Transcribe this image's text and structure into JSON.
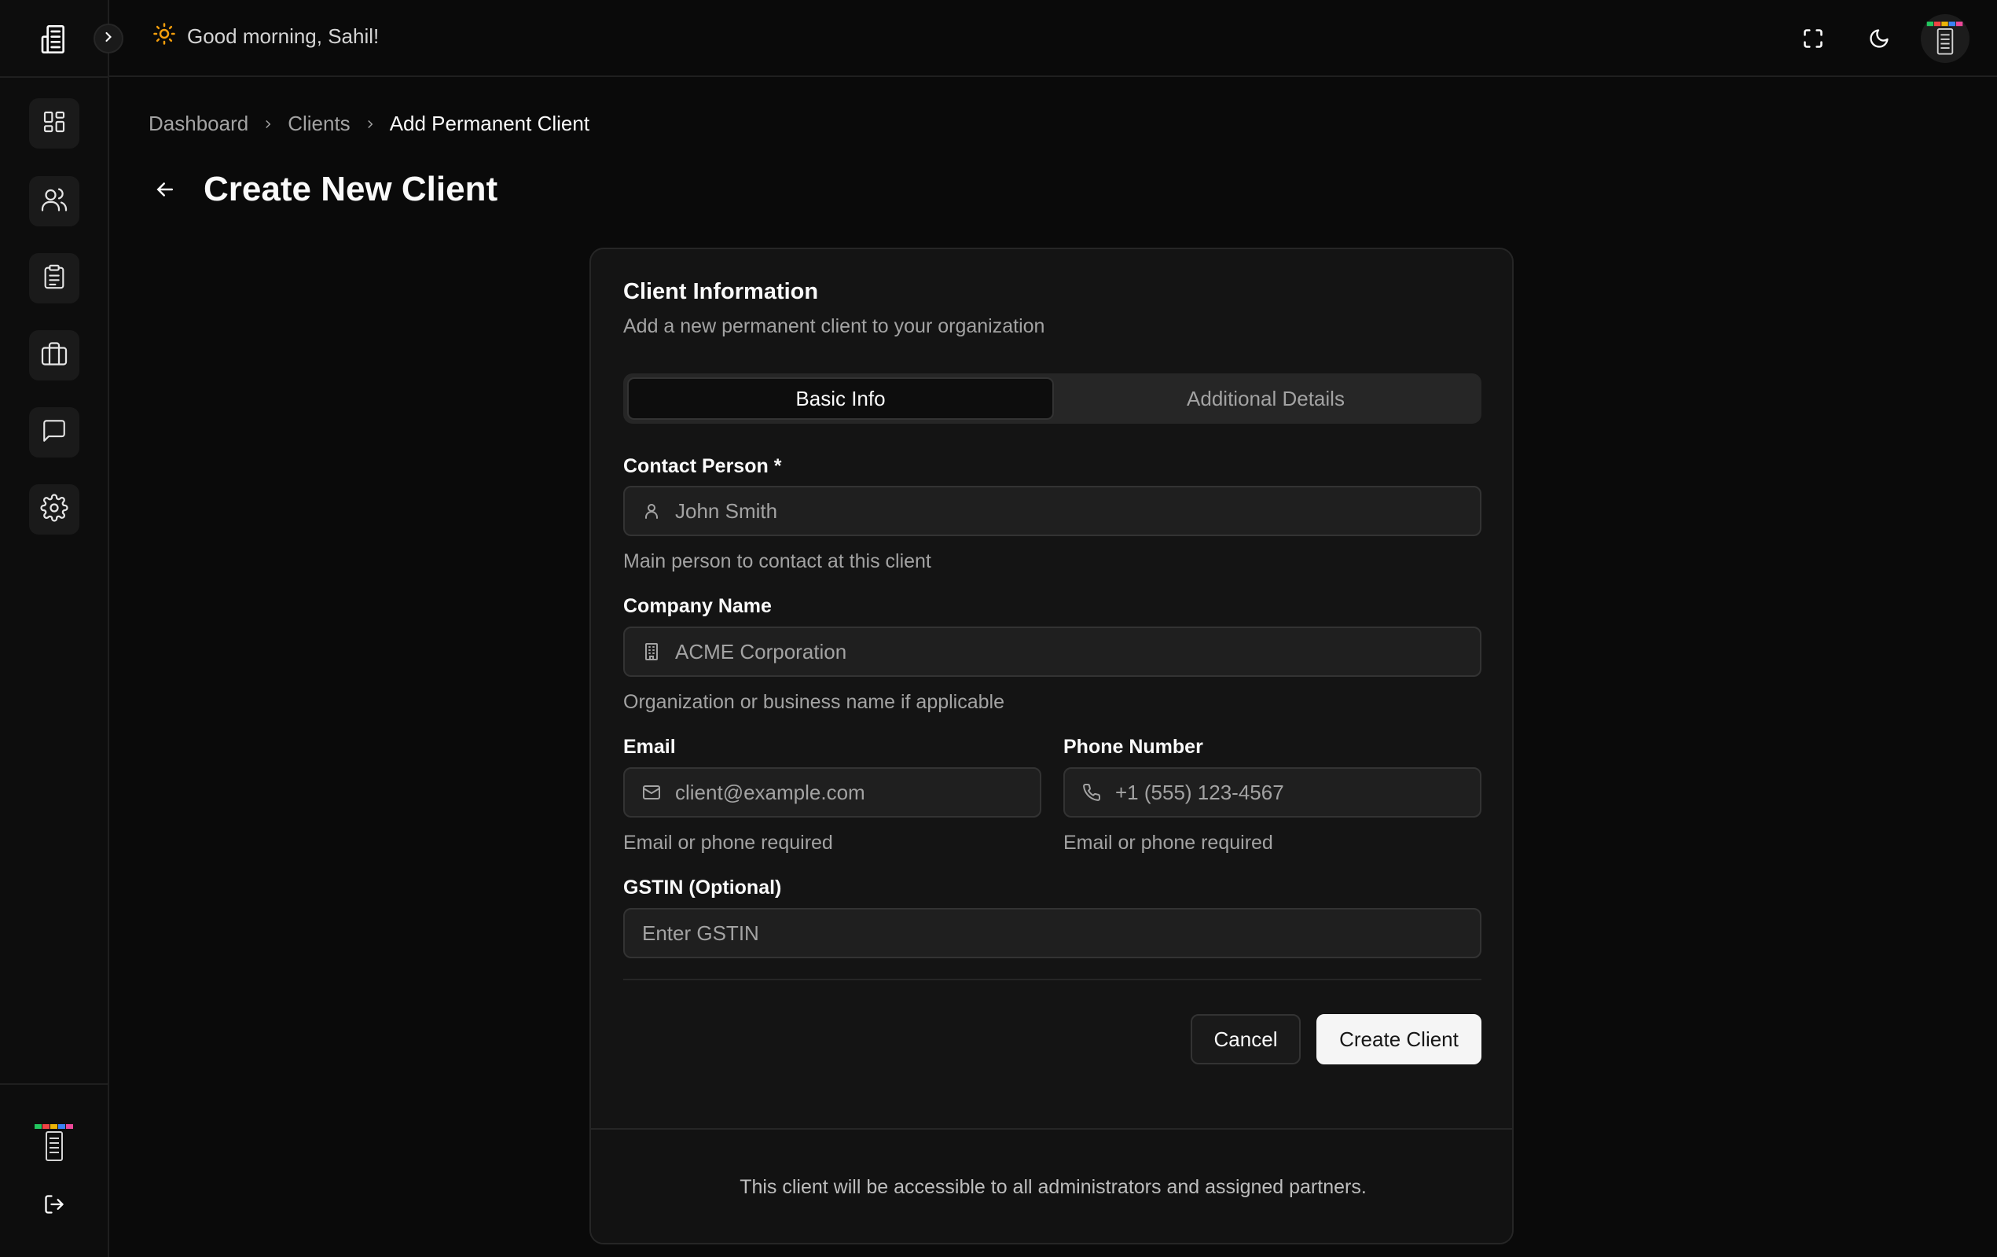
{
  "topbar": {
    "greeting": "Good morning, Sahil!",
    "icons": [
      "sun-icon",
      "fullscreen-icon",
      "moon-icon"
    ]
  },
  "sidebar": {
    "items": [
      {
        "name": "dashboard",
        "icon": "grid-icon"
      },
      {
        "name": "clients",
        "icon": "users-icon"
      },
      {
        "name": "tasks",
        "icon": "clipboard-icon"
      },
      {
        "name": "work",
        "icon": "briefcase-icon"
      },
      {
        "name": "messages",
        "icon": "chat-icon"
      },
      {
        "name": "settings",
        "icon": "gear-icon"
      }
    ]
  },
  "breadcrumb": {
    "items": [
      "Dashboard",
      "Clients"
    ],
    "current": "Add Permanent Client"
  },
  "page": {
    "title": "Create New Client"
  },
  "card": {
    "title": "Client Information",
    "description": "Add a new permanent client to your organization",
    "tabs": [
      {
        "label": "Basic Info",
        "active": true
      },
      {
        "label": "Additional Details",
        "active": false
      }
    ],
    "fields": {
      "contact_person": {
        "label": "Contact Person *",
        "placeholder": "John Smith",
        "hint": "Main person to contact at this client"
      },
      "company_name": {
        "label": "Company Name",
        "placeholder": "ACME Corporation",
        "hint": "Organization or business name if applicable"
      },
      "email": {
        "label": "Email",
        "placeholder": "client@example.com",
        "hint": "Email or phone required"
      },
      "phone": {
        "label": "Phone Number",
        "placeholder": "+1 (555) 123-4567",
        "hint": "Email or phone required"
      },
      "gstin": {
        "label": "GSTIN (Optional)",
        "placeholder": "Enter GSTIN"
      }
    },
    "buttons": {
      "cancel": "Cancel",
      "create": "Create Client"
    },
    "footer": "This client will be accessible to all administrators and assigned partners."
  },
  "colors": {
    "background": "#0a0a0a",
    "card": "#141414",
    "accent_sun": "#f59e0b",
    "primary_button": "#f5f5f5"
  }
}
